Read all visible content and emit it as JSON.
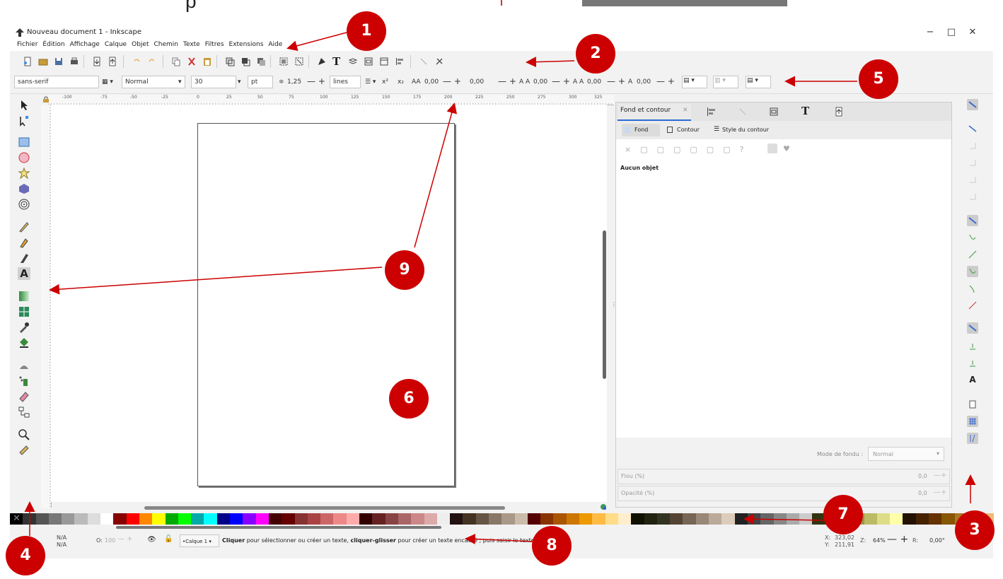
{
  "top_strip": {
    "text": "p"
  },
  "window": {
    "title": "Nouveau document 1 - Inkscape",
    "controls": {
      "minimize": "−",
      "maximize": "□",
      "close": "✕"
    }
  },
  "menu": [
    "Fichier",
    "Édition",
    "Affichage",
    "Calque",
    "Objet",
    "Chemin",
    "Texte",
    "Filtres",
    "Extensions",
    "Aide"
  ],
  "textbar": {
    "font_family": "sans-serif",
    "font_style": "Normal",
    "font_size": "30",
    "unit": "pt",
    "line_height": "1,25",
    "line_unit": "lines",
    "letter_spacing": "0,00",
    "word_spacing": "0,00",
    "hkern": "0,00",
    "vkern": "0,00",
    "rotation": "0,00"
  },
  "ruler_labels": [
    "-100",
    "-75",
    "-50",
    "-25",
    "0",
    "25",
    "50",
    "75",
    "100",
    "125",
    "150",
    "175",
    "200",
    "225",
    "250",
    "275",
    "300",
    "325"
  ],
  "panel": {
    "tabs": [
      "Fond et contour"
    ],
    "subtabs": {
      "fill": "Fond",
      "stroke": "Contour",
      "stroke_style": "Style du contour"
    },
    "no_object": "Aucun objet",
    "blend_label": "Mode de fondu :",
    "blend_value": "Normal",
    "blur_label": "Flou (%)",
    "blur_value": "0,0",
    "opacity_label": "Opacité (%)",
    "opacity_value": "0,0"
  },
  "status": {
    "fill_label": "N/A",
    "stroke_label": "N/A",
    "opacity_label": "O:",
    "opacity_value": "100",
    "layer": "•Calque 1",
    "message_bold1": "Cliquer",
    "message_1": " pour sélectionner ou créer un texte, ",
    "message_bold2": "cliquer-glisser",
    "message_2": " pour créer un texte encadré ; puis saisir le texte.",
    "x_label": "X:",
    "x_value": "323,02",
    "y_label": "Y:",
    "y_value": "211,91",
    "zoom_label": "Z:",
    "zoom_value": "64%",
    "rotation_label": "R:",
    "rotation_value": "0,00°"
  },
  "callouts": [
    "1",
    "2",
    "3",
    "4",
    "5",
    "6",
    "7",
    "8",
    "9"
  ],
  "colors": {
    "callout": "#cc0000",
    "accent": "#2b6bd6"
  }
}
